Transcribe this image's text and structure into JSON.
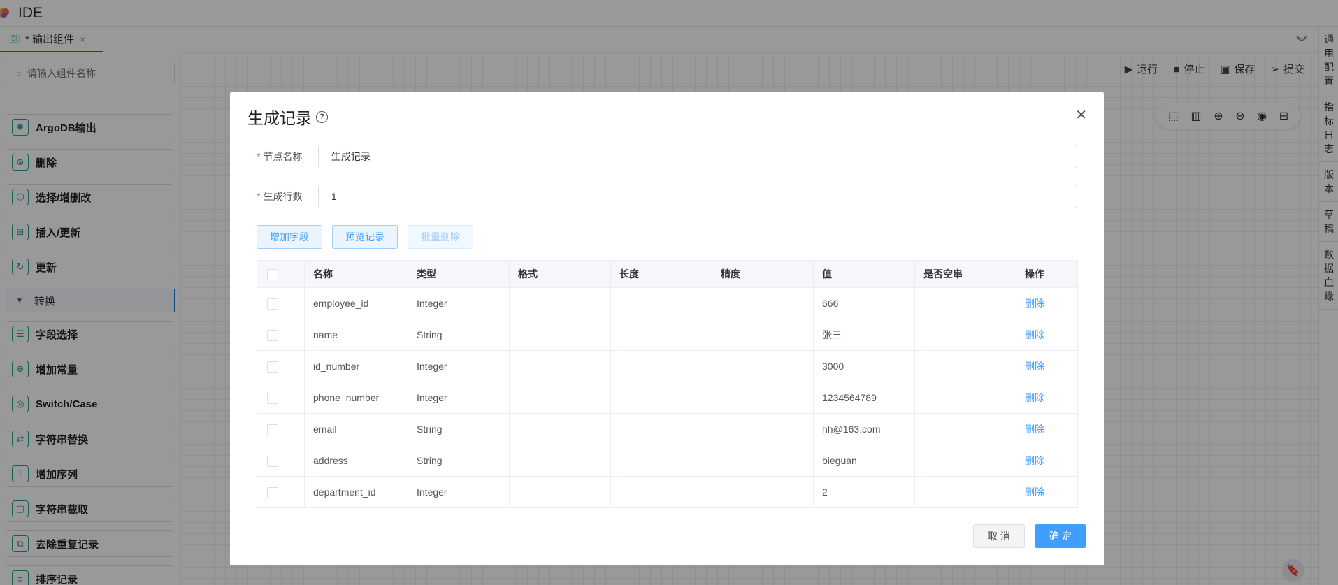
{
  "app": {
    "title": "IDE"
  },
  "tab": {
    "badge": "DI",
    "label": "* 输出组件",
    "close": "×"
  },
  "sidebar": {
    "search_placeholder": "请输入组件名称",
    "items_top": [
      {
        "label": "ArgoDB输出",
        "icon": "argodb-icon",
        "glyph": "✺"
      },
      {
        "label": "删除",
        "icon": "delete-circle-icon",
        "glyph": "⊗"
      },
      {
        "label": "选择/增删改",
        "icon": "cube-icon",
        "glyph": "⬡"
      },
      {
        "label": "插入/更新",
        "icon": "insert-icon",
        "glyph": "⊞"
      },
      {
        "label": "更新",
        "icon": "refresh-icon",
        "glyph": "↻"
      }
    ],
    "group": {
      "label": "转换"
    },
    "items_group": [
      {
        "label": "字段选择",
        "icon": "field-select-icon",
        "glyph": "☰"
      },
      {
        "label": "增加常量",
        "icon": "add-constant-icon",
        "glyph": "⊕"
      },
      {
        "label": "Switch/Case",
        "icon": "switch-icon",
        "glyph": "◎"
      },
      {
        "label": "字符串替换",
        "icon": "replace-icon",
        "glyph": "⇄"
      },
      {
        "label": "增加序列",
        "icon": "sequence-icon",
        "glyph": "⋮"
      },
      {
        "label": "字符串截取",
        "icon": "substring-icon",
        "glyph": "▢"
      },
      {
        "label": "去除重复记录",
        "icon": "dedupe-icon",
        "glyph": "⧉"
      },
      {
        "label": "排序记录",
        "icon": "sort-icon",
        "glyph": "≡"
      }
    ]
  },
  "toolbar": {
    "run": "运行",
    "stop": "停止",
    "save": "保存",
    "submit": "提交"
  },
  "rightbar": [
    "通用配置",
    "指标日志",
    "版本",
    "草稿",
    "数据血缘"
  ],
  "modal": {
    "title": "生成记录",
    "fields": {
      "node_name_label": "节点名称",
      "node_name_value": "生成记录",
      "row_count_label": "生成行数",
      "row_count_value": "1"
    },
    "buttons": {
      "add_field": "增加字段",
      "preview": "预览记录",
      "batch_delete": "批量删除"
    },
    "table": {
      "columns": [
        "名称",
        "类型",
        "格式",
        "长度",
        "精度",
        "值",
        "是否空串",
        "操作"
      ],
      "rows": [
        {
          "name": "employee_id",
          "type": "Integer",
          "format": "",
          "length": "",
          "precision": "",
          "value": "666",
          "empty": "",
          "action": "删除"
        },
        {
          "name": "name",
          "type": "String",
          "format": "",
          "length": "",
          "precision": "",
          "value": "张三",
          "empty": "",
          "action": "删除"
        },
        {
          "name": "id_number",
          "type": "Integer",
          "format": "",
          "length": "",
          "precision": "",
          "value": "3000",
          "empty": "",
          "action": "删除"
        },
        {
          "name": "phone_number",
          "type": "Integer",
          "format": "",
          "length": "",
          "precision": "",
          "value": "1234564789",
          "empty": "",
          "action": "删除"
        },
        {
          "name": "email",
          "type": "String",
          "format": "",
          "length": "",
          "precision": "",
          "value": "hh@163.com",
          "empty": "",
          "action": "删除"
        },
        {
          "name": "address",
          "type": "String",
          "format": "",
          "length": "",
          "precision": "",
          "value": "bieguan",
          "empty": "",
          "action": "删除"
        },
        {
          "name": "department_id",
          "type": "Integer",
          "format": "",
          "length": "",
          "precision": "",
          "value": "2",
          "empty": "",
          "action": "删除"
        }
      ]
    },
    "footer": {
      "cancel": "取 消",
      "ok": "确 定"
    }
  }
}
